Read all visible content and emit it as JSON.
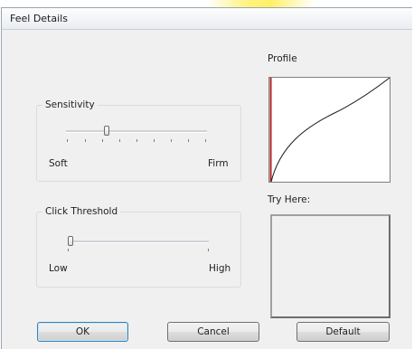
{
  "window": {
    "title": "Feel Details"
  },
  "sensitivity": {
    "group_label": "Sensitivity",
    "min_label": "Soft",
    "max_label": "Firm",
    "value_fraction": 0.27
  },
  "click_threshold": {
    "group_label": "Click Threshold",
    "min_label": "Low",
    "max_label": "High",
    "value_fraction": 0.0
  },
  "profile": {
    "label": "Profile",
    "axis_color": "#b22222",
    "curve_color": "#1a1a1a"
  },
  "try_here": {
    "label": "Try Here:"
  },
  "buttons": {
    "ok_label": "OK",
    "cancel_label": "Cancel",
    "default_label": "Default"
  }
}
